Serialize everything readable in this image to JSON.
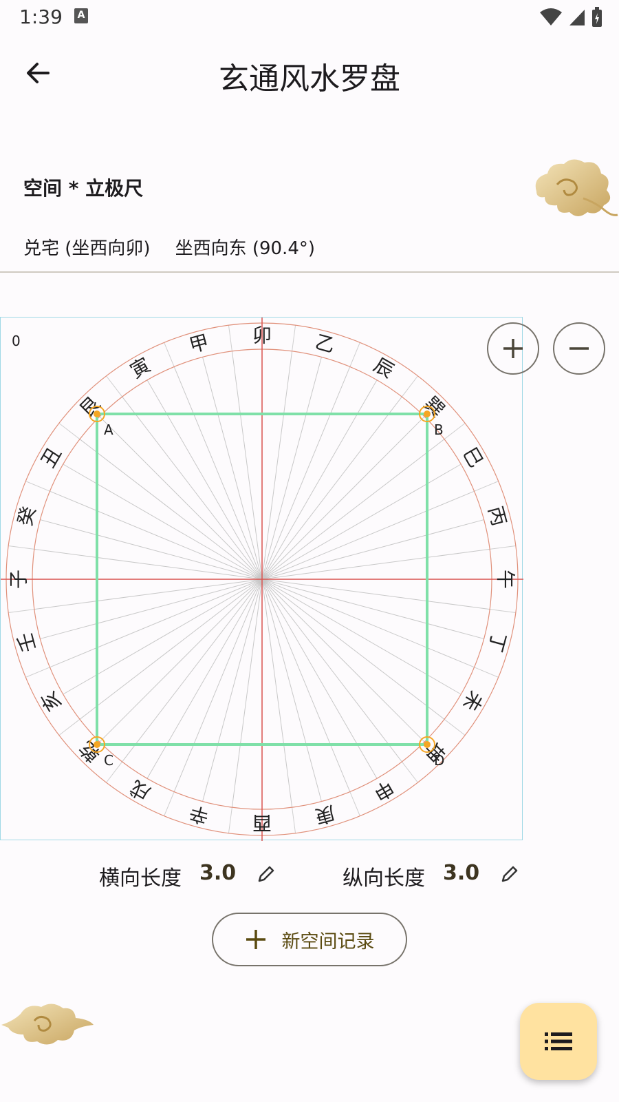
{
  "status_bar": {
    "time": "1:39",
    "notification_badge": "A"
  },
  "app_bar": {
    "title": "玄通风水罗盘",
    "back_icon": "arrow-left-icon"
  },
  "section": {
    "title": "空间 * 立极尺"
  },
  "info": {
    "house": "兑宅 (坐西向卯)",
    "direction": "坐西向东 (90.4°)"
  },
  "compass": {
    "zoom_level": "0",
    "mountains": [
      "卯",
      "乙",
      "辰",
      "巽",
      "巳",
      "丙",
      "午",
      "丁",
      "未",
      "坤",
      "申",
      "庚",
      "酉",
      "辛",
      "戌",
      "乾",
      "亥",
      "壬",
      "子",
      "癸",
      "丑",
      "艮",
      "寅",
      "甲"
    ],
    "corner_labels": [
      "A",
      "B",
      "C",
      "D"
    ],
    "colors": {
      "ring": "#e0907a",
      "axis": "#d9534f",
      "rect": "#7fe0a8",
      "corner": "#f5a623",
      "spoke": "#c8c8c8"
    }
  },
  "zoom": {
    "in_icon": "plus-icon",
    "out_icon": "minus-icon"
  },
  "dimensions": {
    "horizontal_label": "横向长度",
    "horizontal_value": "3.0",
    "vertical_label": "纵向长度",
    "vertical_value": "3.0"
  },
  "new_record": {
    "label": "新空间记录",
    "icon": "plus-icon"
  },
  "fab": {
    "icon": "list-icon"
  }
}
